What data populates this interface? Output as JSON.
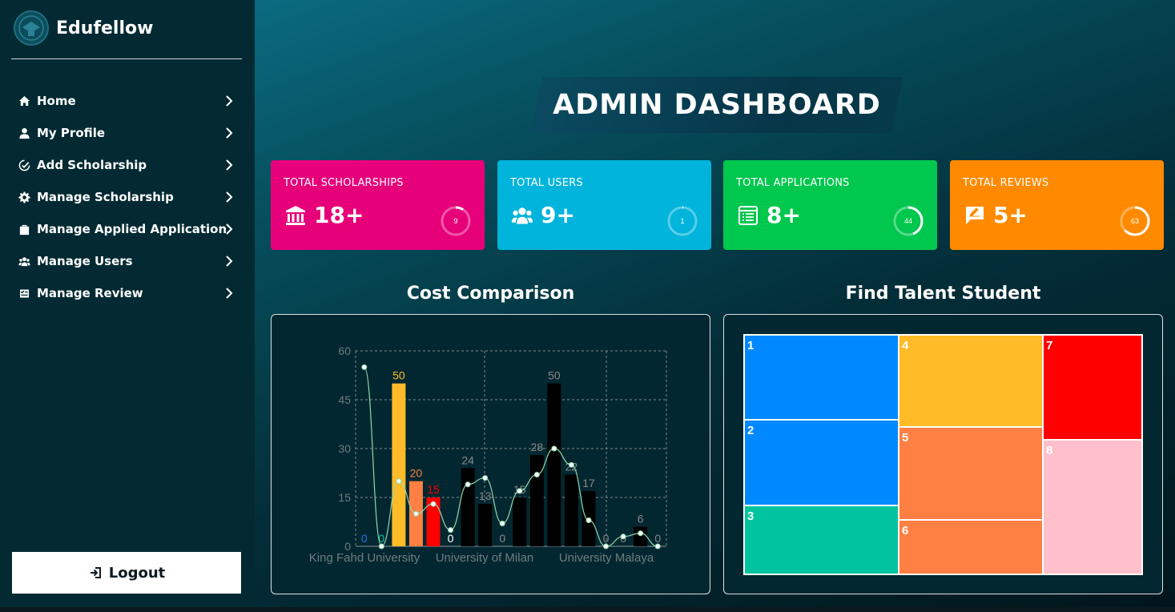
{
  "sidebar": {
    "brand": "Edufellow",
    "items": [
      {
        "label": "Home",
        "icon": "home-icon"
      },
      {
        "label": "My Profile",
        "icon": "user-icon"
      },
      {
        "label": "Add Scholarship",
        "icon": "badge-check-icon"
      },
      {
        "label": "Manage Scholarship",
        "icon": "gear-icon"
      },
      {
        "label": "Manage Applied Application",
        "icon": "briefcase-icon"
      },
      {
        "label": "Manage Users",
        "icon": "users-icon"
      },
      {
        "label": "Manage Review",
        "icon": "review-icon"
      }
    ],
    "logout_label": "Logout"
  },
  "header": {
    "title": "ADMIN DASHBOARD"
  },
  "cards": [
    {
      "label": "TOTAL SCHOLARSHIPS",
      "value": "18+",
      "ring": "9",
      "color": "#e6007a",
      "icon": "bank-icon"
    },
    {
      "label": "TOTAL USERS",
      "value": "9+",
      "ring": "1",
      "color": "#00b4dc",
      "icon": "users-icon"
    },
    {
      "label": "TOTAL APPLICATIONS",
      "value": "8+",
      "ring": "44",
      "color": "#00c74d",
      "icon": "application-icon"
    },
    {
      "label": "TOTAL REVIEWS",
      "value": "5+",
      "ring": "63",
      "color": "#ff8a00",
      "icon": "review-icon"
    }
  ],
  "sections": {
    "cost": "Cost Comparison",
    "talent": "Find Talent Student"
  },
  "chart_data": {
    "type": "bar",
    "title": "Cost Comparison",
    "x_tick_labels": [
      "King Fahd University",
      "University of Milan",
      "University Malaya"
    ],
    "ylim": [
      0,
      60
    ],
    "yticks": [
      0,
      15,
      30,
      45,
      60
    ],
    "grid": true,
    "series": [
      {
        "values": [
          0,
          0,
          50,
          20,
          15,
          0,
          24,
          13,
          0,
          15,
          28,
          50,
          22,
          17,
          0,
          0,
          6,
          0
        ],
        "colors": [
          "#1a73e8",
          "#00c49f",
          "#ffbb28",
          "#ff8042",
          "#ff0000",
          "#000000",
          "#000000",
          "#000000",
          "#000000",
          "#000000",
          "#000000",
          "#000000",
          "#000000",
          "#000000",
          "#000000",
          "#000000",
          "#000000",
          "#000000"
        ],
        "label_colors": [
          "#1a73e8",
          "#00c49f",
          "#ffbb28",
          "#ff8042",
          "#ff0000",
          "#ffffff",
          "#888888",
          "#888888",
          "#888888",
          "#888888",
          "#888888",
          "#888888",
          "#888888",
          "#888888",
          "#888888",
          "#888888",
          "#888888",
          "#888888"
        ]
      },
      {
        "type": "line",
        "values": [
          55,
          0,
          20,
          10,
          13,
          5,
          19,
          21,
          7,
          17,
          22,
          30,
          25,
          8,
          0,
          3,
          4,
          0
        ],
        "color": "#8fd9a8"
      }
    ]
  },
  "treemap": {
    "tiles": [
      {
        "label": "1",
        "color": "#0088fe"
      },
      {
        "label": "2",
        "color": "#0088fe"
      },
      {
        "label": "3",
        "color": "#00c49f"
      },
      {
        "label": "4",
        "color": "#ffbb28"
      },
      {
        "label": "5",
        "color": "#ff8042"
      },
      {
        "label": "6",
        "color": "#ff8042"
      },
      {
        "label": "7",
        "color": "#ff0000"
      },
      {
        "label": "8",
        "color": "#ffc0cb"
      }
    ]
  }
}
